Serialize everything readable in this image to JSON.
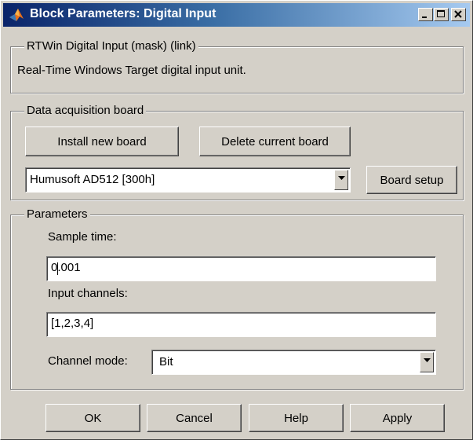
{
  "window": {
    "title": "Block Parameters: Digital Input",
    "app_icon": "matlab-logo-icon",
    "controls": [
      "minimize-icon",
      "maximize-icon",
      "close-icon"
    ]
  },
  "mask_group": {
    "legend": "RTWin Digital Input (mask) (link)",
    "description": "Real-Time Windows Target digital input unit."
  },
  "board_group": {
    "legend": "Data acquisition board",
    "install_label": "Install new board",
    "delete_label": "Delete current board",
    "board_select_value": "Humusoft AD512 [300h]",
    "board_setup_label": "Board setup"
  },
  "params_group": {
    "legend": "Parameters",
    "sample_time_label": "Sample time:",
    "sample_time_value": "0.001",
    "input_channels_label": "Input channels:",
    "input_channels_value": "[1,2,3,4]",
    "channel_mode_label": "Channel mode:",
    "channel_mode_value": "Bit"
  },
  "buttons": {
    "ok": "OK",
    "cancel": "Cancel",
    "help": "Help",
    "apply": "Apply"
  },
  "colors": {
    "title_gradient_start": "#0a246a",
    "title_gradient_end": "#a6caf0",
    "face": "#d4d0c8"
  }
}
